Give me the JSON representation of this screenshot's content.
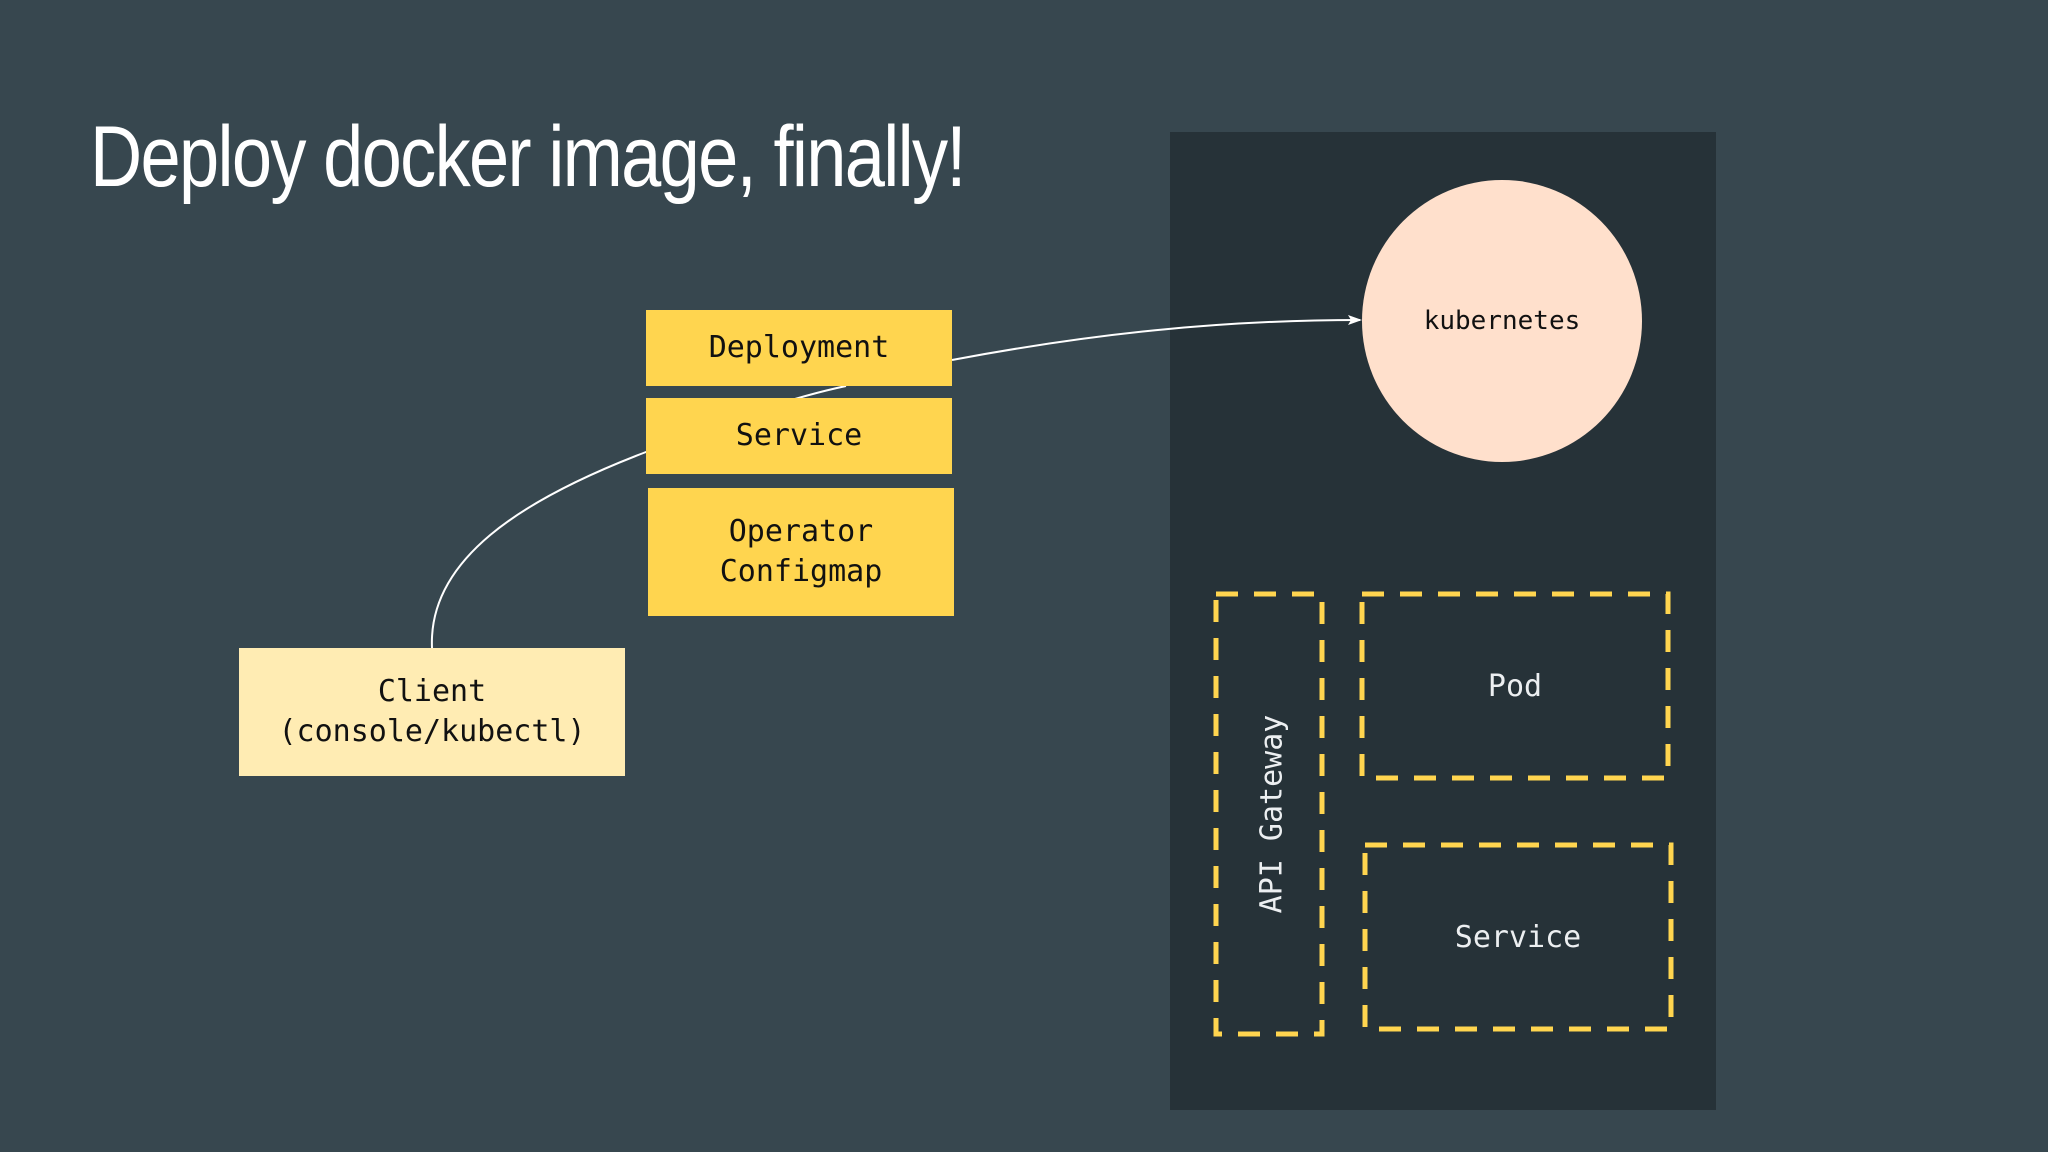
{
  "slide": {
    "title": "Deploy docker image, finally!"
  },
  "diagram": {
    "client_line1": "Client",
    "client_line2": "(console/kubectl)",
    "deployment": "Deployment",
    "service": "Service",
    "operator_line1": "Operator",
    "operator_line2": "Configmap",
    "kubernetes": "kubernetes",
    "api_gateway": "API Gateway",
    "pod": "Pod",
    "cluster_service": "Service"
  },
  "colors": {
    "background": "#37474f",
    "cluster_background": "#263238",
    "resource_yellow": "#ffd54f",
    "client_cream": "#ffecb3",
    "kubernetes_peach": "#ffe0cc",
    "dashed_yellow": "#ffd54f",
    "connector": "#ffffff"
  }
}
